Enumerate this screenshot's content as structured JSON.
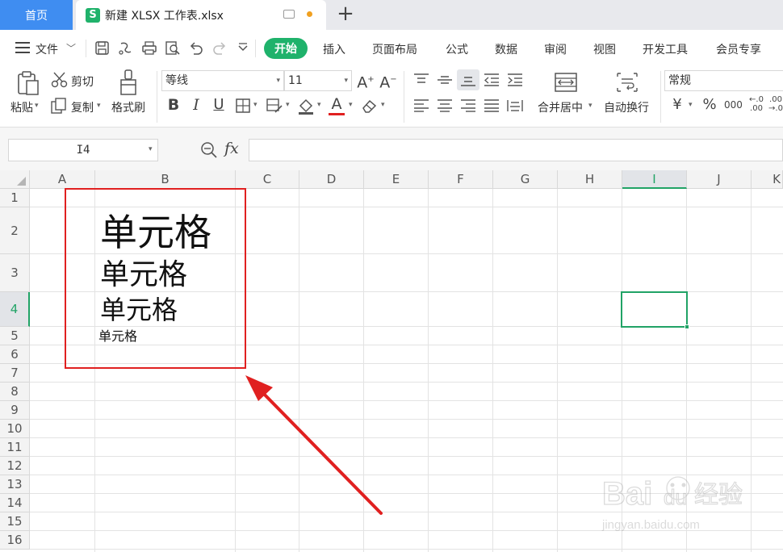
{
  "titlebar": {
    "home_tab": "首页",
    "doc_tab": "新建 XLSX 工作表.xlsx",
    "new_tab_symbol": "+"
  },
  "menubar": {
    "file_menu": "文件",
    "items": [
      "开始",
      "插入",
      "页面布局",
      "公式",
      "数据",
      "审阅",
      "视图",
      "开发工具",
      "会员专享"
    ],
    "active": "开始"
  },
  "ribbon": {
    "paste": "粘贴",
    "cut": "剪切",
    "copy": "复制",
    "format_painter": "格式刷",
    "font_name": "等线",
    "font_size": "11",
    "merge_center": "合并居中",
    "wrap_text": "自动换行",
    "number_format": "常规"
  },
  "formulabar": {
    "name_box": "I4",
    "fx": "fx",
    "value": ""
  },
  "grid": {
    "columns": [
      "A",
      "B",
      "C",
      "D",
      "E",
      "F",
      "G",
      "H",
      "I",
      "J",
      "K"
    ],
    "rows": [
      "1",
      "2",
      "3",
      "4",
      "5",
      "6",
      "7",
      "8",
      "9",
      "10",
      "11",
      "12",
      "13",
      "14",
      "15",
      "16"
    ],
    "selected_column": "I",
    "selected_row": "4",
    "cells": {
      "B2": "单元格",
      "B3": "单元格",
      "B4": "单元格",
      "B5": "单元格"
    }
  },
  "colors": {
    "accent_green": "#1fb26b",
    "home_tab_blue": "#3f8df1",
    "annotation_red": "#e02020",
    "selection_green": "#21a366"
  },
  "watermark": "Baidu经验 jingyan.baidu.com"
}
